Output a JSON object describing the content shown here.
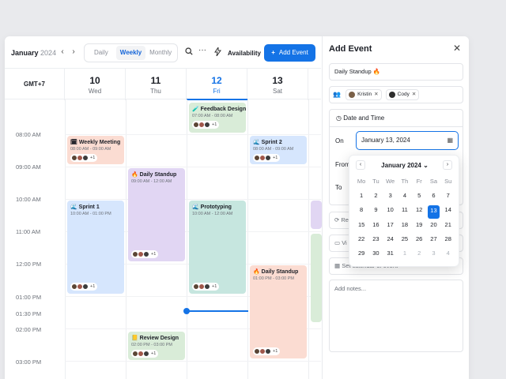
{
  "toolbar": {
    "month": "January",
    "year": "2024",
    "prev": "‹",
    "next": "›",
    "views": [
      "Daily",
      "Weekly",
      "Monthly"
    ],
    "active_view": "Weekly",
    "availability": "Availability",
    "add_event": "Add Event"
  },
  "calendar": {
    "timezone": "GMT+7",
    "days": [
      {
        "num": "10",
        "dow": "Wed"
      },
      {
        "num": "11",
        "dow": "Thu"
      },
      {
        "num": "12",
        "dow": "Fri"
      },
      {
        "num": "13",
        "dow": "Sat"
      }
    ],
    "times": [
      "08:00 AM",
      "09:00 AM",
      "10:00 AM",
      "11:00 AM",
      "12:00 PM",
      "01:00 PM",
      "01:30 PM",
      "02:00 PM",
      "03:00 PM"
    ],
    "events": {
      "weekly": {
        "title": "🗓 Weekly Meeting",
        "time": "08:00 AM - 09:00 AM",
        "extra": "+1"
      },
      "sprint1": {
        "title": "🌊 Sprint 1",
        "time": "10:00 AM - 01:00 PM",
        "extra": "+1"
      },
      "standup_thu": {
        "title": "🔥 Daily Standup",
        "time": "09:00 AM - 12:00 AM",
        "extra": "+1"
      },
      "review": {
        "title": "📒 Review Design",
        "time": "02:00 PM - 03:00 PM",
        "extra": "+1"
      },
      "feedback": {
        "title": "🧪 Feedback Design",
        "time": "07:00 AM - 08:00 AM",
        "extra": "+1"
      },
      "prototyping": {
        "title": "🌊 Prototyping",
        "time": "10:00 AM - 12:00 AM",
        "extra": "+1"
      },
      "sprint2": {
        "title": "🌊 Sprint 2",
        "time": "08:00 AM - 09:00 AM",
        "extra": "+1"
      },
      "standup_sat": {
        "title": "🔥 Daily Standup",
        "time": "01:00 PM - 03:00 PM",
        "extra": "+1"
      }
    }
  },
  "panel": {
    "title": "Add Event",
    "close": "✕",
    "event_name": "Daily Standup 🔥",
    "guests": [
      "Kristin",
      "Cody"
    ],
    "date_time_label": "Date and Time",
    "on_label": "On",
    "on_value": "January 13, 2024",
    "from_label": "From",
    "to_label": "To",
    "repeat_hint": "Re",
    "video_hint": "Vi",
    "calendar_hint": "Set calendar of event",
    "notes_placeholder": "Add notes..."
  },
  "picker": {
    "header": "January 2024",
    "weekdays": [
      "Mo",
      "Tu",
      "We",
      "Th",
      "Fr",
      "Sa",
      "Su"
    ],
    "weeks": [
      [
        "1",
        "2",
        "3",
        "4",
        "5",
        "6",
        "7"
      ],
      [
        "8",
        "9",
        "10",
        "11",
        "12",
        "13",
        "14"
      ],
      [
        "15",
        "16",
        "17",
        "18",
        "19",
        "20",
        "21"
      ],
      [
        "22",
        "23",
        "24",
        "25",
        "26",
        "27",
        "28"
      ],
      [
        "29",
        "30",
        "31",
        "1",
        "2",
        "3",
        "4"
      ]
    ],
    "selected": "13"
  }
}
